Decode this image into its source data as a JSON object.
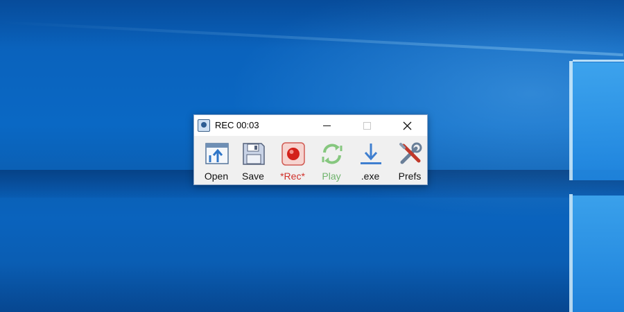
{
  "window": {
    "title": "REC 00:03",
    "controls": {
      "minimize": "minimize",
      "maximize": "maximize",
      "close": "close"
    }
  },
  "toolbar": {
    "items": [
      {
        "label": "Open",
        "icon": "open-icon"
      },
      {
        "label": "Save",
        "icon": "save-icon"
      },
      {
        "label": "*Rec*",
        "icon": "record-icon"
      },
      {
        "label": "Play",
        "icon": "play-icon"
      },
      {
        "label": ".exe",
        "icon": "export-exe-icon"
      },
      {
        "label": "Prefs",
        "icon": "preferences-icon"
      }
    ]
  },
  "colors": {
    "desktop": "#0a63bd",
    "window_bg": "#f0f0f0",
    "rec_label": "#d0302a",
    "play_label": "#6fb46d",
    "icon_blue": "#3f7fd0"
  }
}
